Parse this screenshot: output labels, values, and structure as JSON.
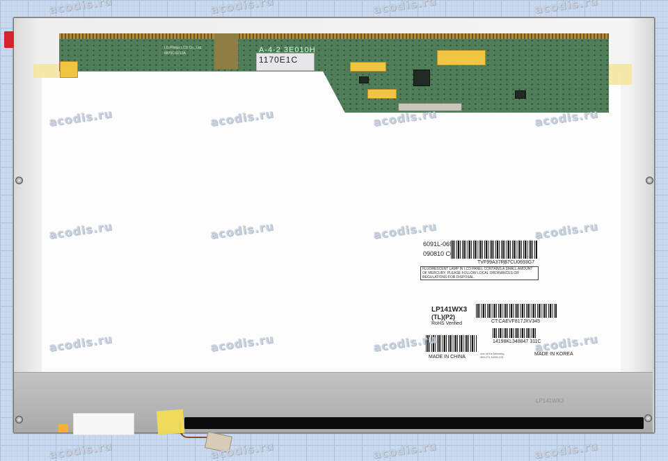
{
  "watermark": "acodis.ru",
  "pcb": {
    "label_top": "A-4-2 3E010H",
    "label_code": "1170E1C",
    "maker_text": "LG.Philips LCD Co., Ltd.",
    "model_text": "6870C-0212A"
  },
  "labels": {
    "part_number": "6091L-0693G",
    "date_code": "090810  C67",
    "serial_top": "TVF99A37RB7CU0693G7",
    "notice": "FLUORESCENT LAMP IN LCD PANEL CONTAINS A SMALL AMOUNT OF MERCURY. PLEASE FOLLOW LOCAL ORDINANCES OR REGULATIONS FOR DISPOSAL.",
    "model": "LP141WX3",
    "model_sub": "(TL)(P2)",
    "rohs": "RoHS Verified",
    "ct_code": "CT:CAEVF817JXV345",
    "serial_bottom": "14198KL348847  311C",
    "patent": "one of the following 389,271 5,635,133",
    "made_in_china": "MADE IN CHINA",
    "made_in_korea": "MADE IN KOREA",
    "bezel_text": "LP141WX3"
  },
  "colors": {
    "pcb_green": "#4f7d58",
    "gold_pad": "#f0c542",
    "grid_bg": "#c9d9ee",
    "tape_yellow": "#f2dc55"
  }
}
